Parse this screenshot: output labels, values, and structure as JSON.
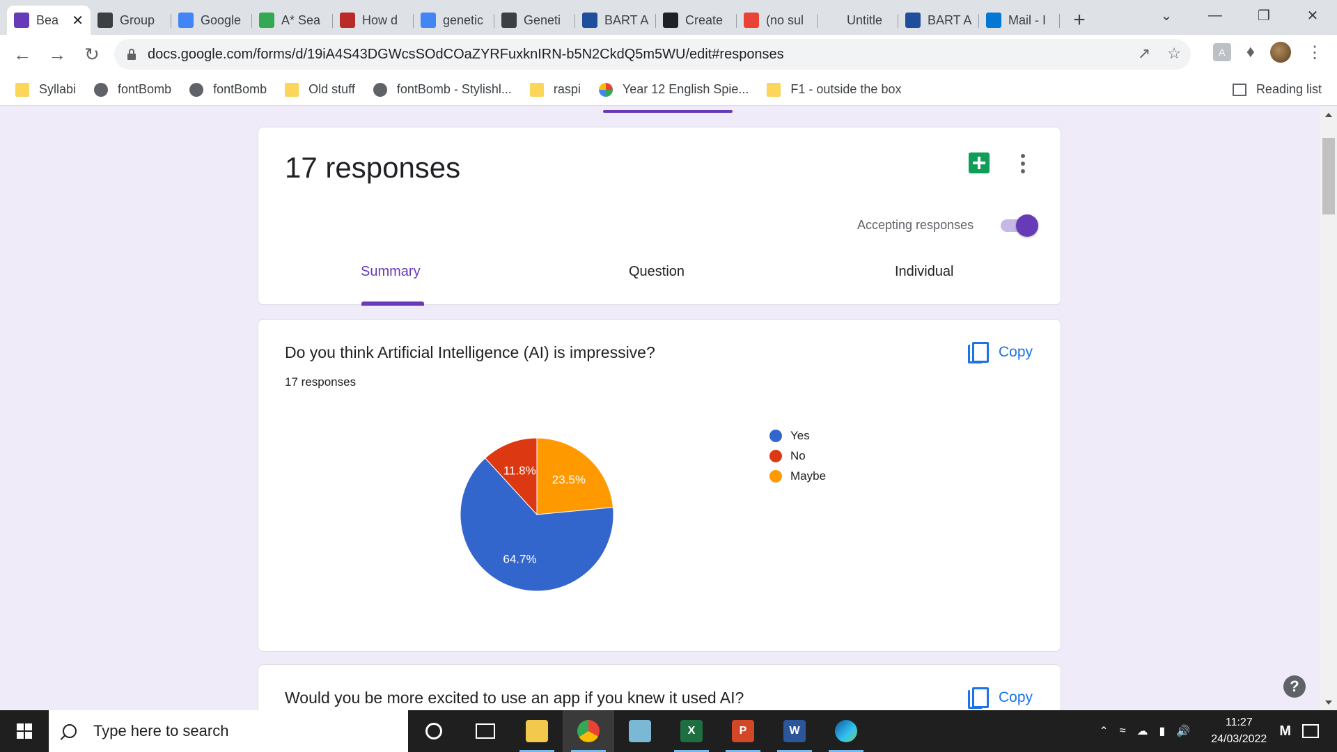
{
  "browser": {
    "tabs": [
      {
        "title": "Bea",
        "favicon": "forms-icon",
        "color": "#673ab7",
        "active": true
      },
      {
        "title": "Group",
        "favicon": "classroom-icon",
        "color": "#3c4043"
      },
      {
        "title": "Google",
        "favicon": "calendar-icon",
        "color": "#4285f4"
      },
      {
        "title": "A* Sea",
        "favicon": "search-icon",
        "color": "#34a853"
      },
      {
        "title": "How d",
        "favicon": "quora-icon",
        "color": "#b92b27"
      },
      {
        "title": "genetic",
        "favicon": "google-icon",
        "color": "#4285f4"
      },
      {
        "title": "Geneti",
        "favicon": "diamond-icon",
        "color": "#3c4043"
      },
      {
        "title": "BART A",
        "favicon": "e-icon",
        "color": "#1f4e9c"
      },
      {
        "title": "Create",
        "favicon": "create-icon",
        "color": "#202124"
      },
      {
        "title": "(no sul",
        "favicon": "gmail-icon",
        "color": "#ea4335"
      },
      {
        "title": "Untitle",
        "favicon": "blank-icon",
        "color": "#dee1e6"
      },
      {
        "title": "BART A",
        "favicon": "e-icon",
        "color": "#1f4e9c"
      },
      {
        "title": "Mail - I",
        "favicon": "outlook-icon",
        "color": "#0078d4"
      }
    ],
    "url": "docs.google.com/forms/d/19iA4S43DGWcsSOdCOaZYRFuxknIRN-b5N2CkdQ5m5WU/edit#responses",
    "bookmarks": [
      {
        "label": "Syllabi",
        "icon": "folder"
      },
      {
        "label": "fontBomb",
        "icon": "globe"
      },
      {
        "label": "fontBomb",
        "icon": "globe"
      },
      {
        "label": "Old stuff",
        "icon": "folder"
      },
      {
        "label": "fontBomb - Stylishl...",
        "icon": "globe"
      },
      {
        "label": "raspi",
        "icon": "folder"
      },
      {
        "label": "Year 12 English Spie...",
        "icon": "pin"
      },
      {
        "label": "F1 - outside the box",
        "icon": "folder"
      }
    ],
    "reading_list": "Reading list"
  },
  "form": {
    "responses_title": "17 responses",
    "accepting_label": "Accepting responses",
    "accepting_on": true,
    "tabs": {
      "summary": "Summary",
      "question": "Question",
      "individual": "Individual"
    },
    "selected_tab": "Summary",
    "accent": "#673ab7"
  },
  "questions": [
    {
      "title": "Do you think Artificial Intelligence (AI) is impressive?",
      "count": "17 responses",
      "copy_label": "Copy"
    },
    {
      "title": "Would you be more excited to use an app if you knew it used AI?",
      "copy_label": "Copy"
    }
  ],
  "chart_data": {
    "type": "pie",
    "categories": [
      "Yes",
      "No",
      "Maybe"
    ],
    "values": [
      64.7,
      11.8,
      23.5
    ],
    "labels": [
      "64.7%",
      "11.8%",
      "23.5%"
    ],
    "colors": [
      "#3366cc",
      "#dc3912",
      "#ff9900"
    ],
    "legend_position": "right"
  },
  "taskbar": {
    "search_placeholder": "Type here to search",
    "time": "11:27",
    "date": "24/03/2022"
  }
}
